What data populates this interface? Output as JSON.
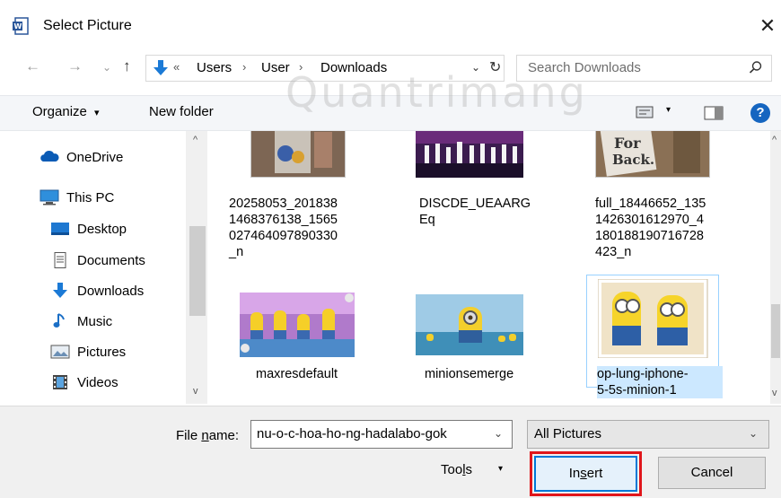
{
  "window": {
    "title": "Select Picture",
    "close_glyph": "✕",
    "app_icon": "word-doc-icon"
  },
  "address_bar": {
    "back_glyph": "←",
    "forward_glyph": "→",
    "recent_glyph": "⌄",
    "up_glyph": "↑",
    "overflow": "«",
    "breadcrumbs": [
      "Users",
      "User",
      "Downloads"
    ],
    "separator": "›",
    "dropdown_glyph": "⌄",
    "refresh_glyph": "↻"
  },
  "search": {
    "placeholder": "Search Downloads"
  },
  "toolbar": {
    "organize_label": "Organize",
    "organize_caret": "▾",
    "new_folder_label": "New folder",
    "view_caret": "▾",
    "help_label": "?"
  },
  "watermark": "Quantrimang",
  "nav_pane": {
    "up_arrow": "^",
    "down_arrow": "v",
    "items": [
      {
        "label": "OneDrive",
        "icon": "cloud-icon"
      },
      {
        "label": "This PC",
        "icon": "computer-icon"
      },
      {
        "label": "Desktop",
        "icon": "desktop-icon"
      },
      {
        "label": "Documents",
        "icon": "documents-icon"
      },
      {
        "label": "Downloads",
        "icon": "download-arrow-icon"
      },
      {
        "label": "Music",
        "icon": "music-note-icon"
      },
      {
        "label": "Pictures",
        "icon": "pictures-icon"
      },
      {
        "label": "Videos",
        "icon": "film-icon"
      }
    ]
  },
  "files": [
    {
      "name": "20258053_2018381468376138_1565027464097890330_n",
      "lines": [
        "20258053_201838",
        "1468376138_1565",
        "027464097890330",
        "_n"
      ]
    },
    {
      "name": "DISCDE_UEAARGEq",
      "lines": [
        "DISCDE_UEAARG",
        "Eq"
      ]
    },
    {
      "name": "full_184466521351426301612970_4180188190716728423_n",
      "lines": [
        "full_18446652_135",
        "1426301612970_4",
        "180188190716728",
        "423_n"
      ]
    },
    {
      "name": "maxresdefault",
      "lines": [
        "maxresdefault"
      ]
    },
    {
      "name": "minionsemerge",
      "lines": [
        "minionsemerge"
      ]
    },
    {
      "name": "op-lung-iphone-5-5s-minion-1",
      "lines": [
        "op-lung-iphone-",
        "5-5s-minion-1"
      ],
      "selected": true
    }
  ],
  "file_scroll": {
    "up_arrow": "^",
    "down_arrow": "v"
  },
  "bottom": {
    "file_name_label_prefix": "File ",
    "file_name_label_u": "n",
    "file_name_label_suffix": "ame:",
    "file_name_value": "nu-o-c-hoa-ho-ng-hadalabo-gok",
    "file_name_dd": "⌄",
    "file_type_value": "All Pictures",
    "file_type_dd": "⌄",
    "tools_prefix": "Too",
    "tools_u": "l",
    "tools_suffix": "s",
    "tools_caret": "▾",
    "insert_prefix": "In",
    "insert_u": "s",
    "insert_suffix": "ert",
    "cancel_label": "Cancel"
  },
  "colors": {
    "accent": "#0078d7",
    "highlight_box": "#e0161b",
    "help_blue": "#1565c0"
  }
}
